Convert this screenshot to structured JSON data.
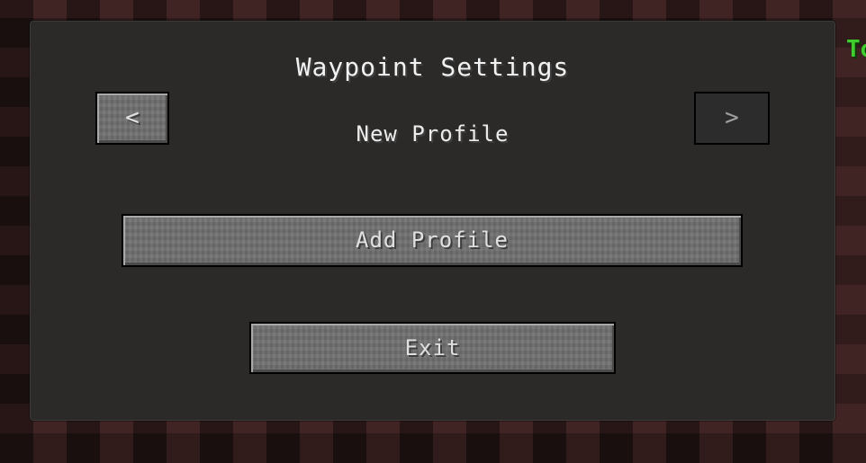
{
  "hud": {
    "corner_text": "To"
  },
  "screen": {
    "title": "Waypoint Settings",
    "profile_name": "New Profile"
  },
  "buttons": {
    "prev_label": "<",
    "next_label": ">",
    "add_profile_label": "Add Profile",
    "exit_label": "Exit"
  },
  "icons": {
    "prev": "chevron-left-icon",
    "next": "chevron-right-icon"
  },
  "colors": {
    "button_face": "#707070",
    "button_disabled": "#2c2c2c",
    "panel": "#2b2a29",
    "hud_text": "#3ecf2e"
  }
}
